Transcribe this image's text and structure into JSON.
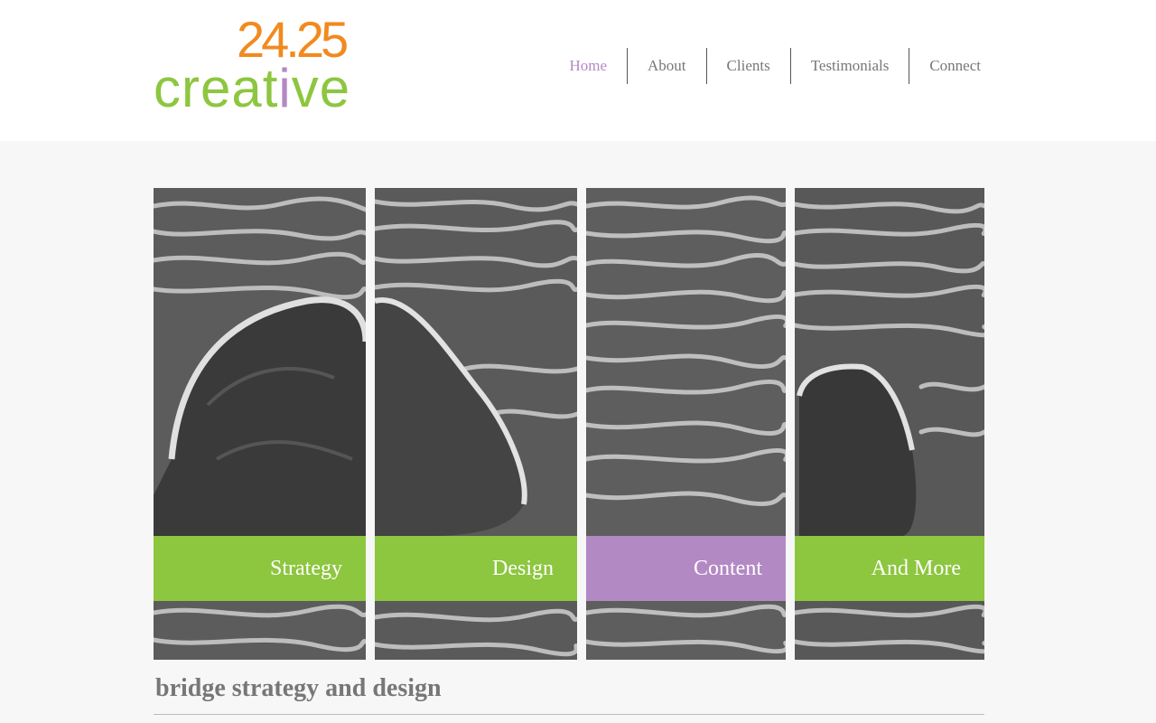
{
  "logo": {
    "number": "24.25",
    "word_prefix": "creat",
    "word_accent": "i",
    "word_suffix": "ve"
  },
  "nav": {
    "items": [
      {
        "label": "Home",
        "active": true
      },
      {
        "label": "About",
        "active": false
      },
      {
        "label": "Clients",
        "active": false
      },
      {
        "label": "Testimonials",
        "active": false
      },
      {
        "label": "Connect",
        "active": false
      }
    ]
  },
  "panels": [
    {
      "label": "Strategy",
      "color": "#8dc63f"
    },
    {
      "label": "Design",
      "color": "#8dc63f"
    },
    {
      "label": "Content",
      "color": "#b389c4"
    },
    {
      "label": "And More",
      "color": "#8dc63f"
    }
  ],
  "tagline": "bridge strategy and design",
  "colors": {
    "orange": "#f18a1f",
    "green": "#8dc63f",
    "purple": "#b389c4",
    "gray_text": "#777777"
  }
}
